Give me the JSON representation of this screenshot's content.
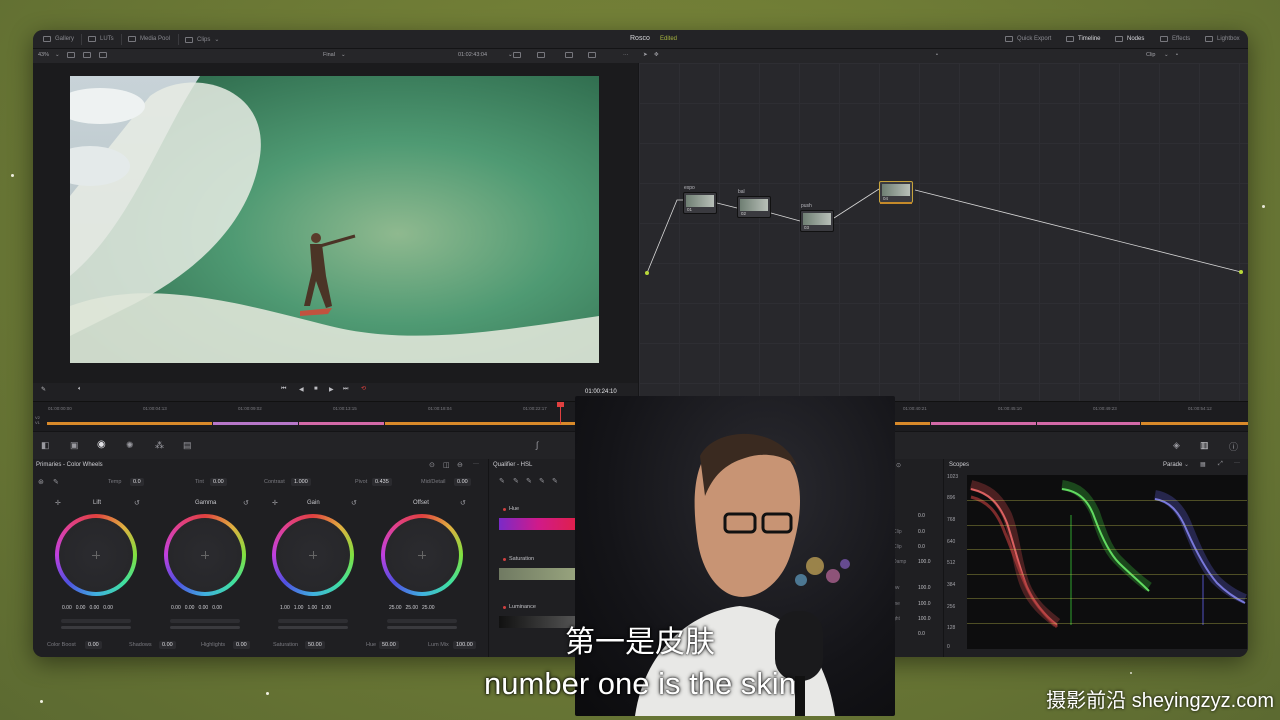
{
  "topbar": {
    "gallery": "Gallery",
    "luts": "LUTs",
    "media_pool": "Media Pool",
    "clips": "Clips",
    "project": "Rosco",
    "status": "Edited",
    "quick_export": "Quick Export",
    "timeline": "Timeline",
    "nodes": "Nodes",
    "effects": "Effects",
    "lightbox": "Lightbox"
  },
  "viewer": {
    "zoom": "43%",
    "version": "Final",
    "timecode": "01:02:43:04",
    "playhead_tc": "01:00:24:10",
    "clip_mode": "Clip"
  },
  "nodes": [
    {
      "label": "expo",
      "num": "01"
    },
    {
      "label": "bal",
      "num": "02"
    },
    {
      "label": "push",
      "num": "03"
    },
    {
      "label": "",
      "num": "04"
    }
  ],
  "timeline": {
    "ticks": [
      "01:00:00:00",
      "01:00:04:13",
      "01:00:09:02",
      "01:00:13:15",
      "01:00:18:04",
      "01:00:22:17",
      "01:00:40:21",
      "01:00:45:10",
      "01:00:49:23",
      "01:00:54:12"
    ],
    "tracks": [
      "V2",
      "V1"
    ]
  },
  "primaries": {
    "title": "Primaries - Color Wheels",
    "temp_label": "Temp",
    "temp": "0.0",
    "tint_label": "Tint",
    "tint": "0.00",
    "contrast_label": "Contrast",
    "contrast": "1.000",
    "pivot_label": "Pivot",
    "pivot": "0.435",
    "middetail_label": "Mid/Detail",
    "middetail": "0.00",
    "wheels": [
      {
        "name": "Lift",
        "vals": [
          "0.00",
          "0.00",
          "0.00",
          "0.00"
        ]
      },
      {
        "name": "Gamma",
        "vals": [
          "0.00",
          "0.00",
          "0.00",
          "0.00"
        ]
      },
      {
        "name": "Gain",
        "vals": [
          "1.00",
          "1.00",
          "1.00",
          "1.00"
        ]
      },
      {
        "name": "Offset",
        "vals": [
          "25.00",
          "25.00",
          "25.00"
        ]
      }
    ],
    "footer": {
      "color_boost_label": "Color Boost",
      "color_boost": "0.00",
      "shadows_label": "Shadows",
      "shadows": "0.00",
      "highlights_label": "Highlights",
      "highlights": "0.00",
      "saturation_label": "Saturation",
      "saturation": "50.00",
      "hue_label": "Hue",
      "hue": "50.00",
      "lum_mix_label": "Lum Mix",
      "lum_mix": "100.00"
    }
  },
  "qualifier": {
    "title": "Qualifier - HSL",
    "hue": "Hue",
    "saturation": "Saturation",
    "luminance": "Luminance"
  },
  "mid_panel": {
    "values": [
      "0.0",
      "0.0",
      "0.0",
      "100.0",
      "100.0",
      "100.0",
      "100.0",
      "0.0"
    ],
    "labels": [
      "Clip",
      "Clip",
      "Damp",
      "ow",
      "me",
      "ght"
    ]
  },
  "scopes": {
    "title": "Scopes",
    "mode": "Parade",
    "ticks": [
      "1023",
      "896",
      "768",
      "640",
      "512",
      "384",
      "256",
      "128",
      "0"
    ]
  },
  "subtitles": {
    "chinese": "第一是皮肤",
    "english": "number one is the skin"
  },
  "watermark": "摄影前沿 sheyingzyz.com",
  "colors": {
    "accent_green": "#a7b53f",
    "node_link": "#d8d84a",
    "scope_red": "#e05050",
    "scope_green": "#40d040",
    "scope_blue": "#6060e0"
  }
}
